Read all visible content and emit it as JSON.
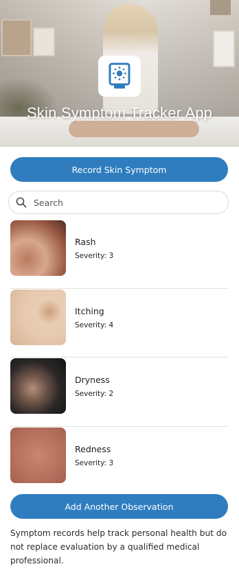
{
  "header": {
    "title": "Skin Symptom Tracker App",
    "icon": "sunscreen-tube-icon",
    "accent": "#2f7dbf"
  },
  "actions": {
    "record_label": "Record Skin Symptom",
    "add_label": "Add Another Observation"
  },
  "search": {
    "placeholder": "Search",
    "icon": "search-icon"
  },
  "symptoms": [
    {
      "name": "Rash",
      "severity": "Severity: 3"
    },
    {
      "name": "Itching",
      "severity": "Severity: 4"
    },
    {
      "name": "Dryness",
      "severity": "Severity: 2"
    },
    {
      "name": "Redness",
      "severity": "Severity: 3"
    }
  ],
  "footer": {
    "disclaimer": "Symptom records help track personal health but do not replace evaluation by a qualified medical professional."
  }
}
